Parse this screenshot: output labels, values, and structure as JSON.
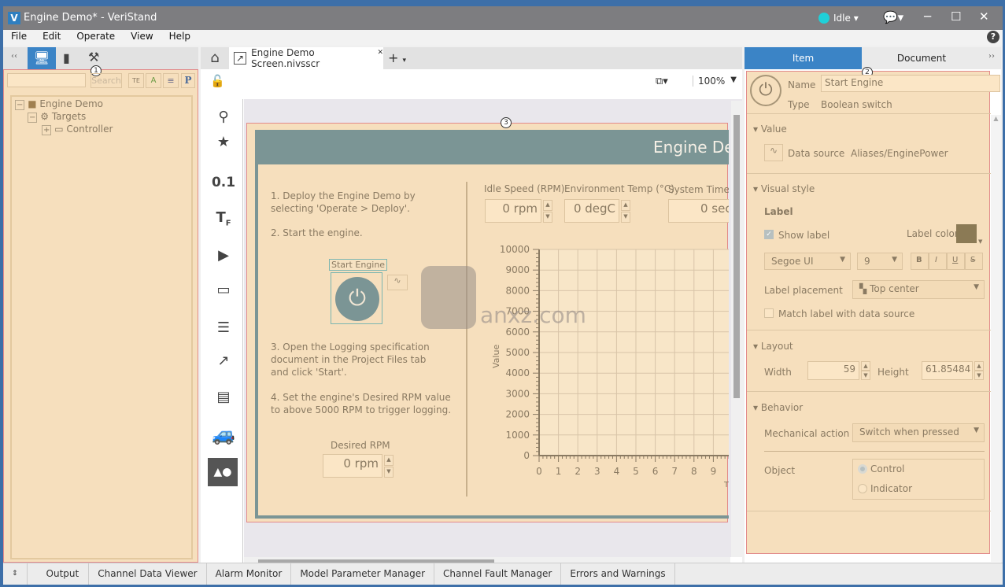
{
  "window": {
    "title": "Engine Demo* - VeriStand",
    "status": "Idle",
    "status_color": "#1fd0d8",
    "logo": "V"
  },
  "menu": [
    "File",
    "Edit",
    "Operate",
    "View",
    "Help"
  ],
  "left_panel": {
    "search_placeholder": "",
    "search_label": "Search",
    "badge": "1",
    "tree": [
      {
        "label": "Engine Demo",
        "icon": "cube-icon",
        "toggle": "−"
      },
      {
        "label": "Targets",
        "icon": "targets-icon",
        "toggle": "−"
      },
      {
        "label": "Controller",
        "icon": "controller-icon",
        "toggle": "+"
      }
    ],
    "tool_buttons": [
      "TE",
      "A",
      "≡",
      "P"
    ]
  },
  "doc_tabs": {
    "active": "Engine Demo Screen.nivsscr",
    "zoom": "100%",
    "badge": "3"
  },
  "palette": [
    "search-icon",
    "star-icon",
    "numeric-icon",
    "text-format-icon",
    "play-icon",
    "dropdown-icon",
    "list-icon",
    "graph-icon",
    "panel-icon",
    "jeep-icon",
    "shapes-icon"
  ],
  "palette_numeric": "0.1",
  "screen": {
    "header": "Engine De",
    "steps": [
      "1. Deploy the Engine Demo by selecting 'Operate > Deploy'.",
      "2. Start the engine.",
      "3. Open the Logging specification document in the Project Files tab and click 'Start'.",
      "4. Set the engine's Desired RPM value to above 5000 RPM to trigger logging."
    ],
    "start_engine_label": "Start Engine",
    "desired_rpm_label": "Desired RPM",
    "desired_rpm_value": "0 rpm",
    "idle_speed_label": "Idle Speed (RPM)",
    "idle_speed_value": "0 rpm",
    "env_temp_label": "Environment Temp (°C)",
    "env_temp_value": "0 degC",
    "sys_time_label": "System Time (s",
    "sys_time_value": "0 sec",
    "accent": "#7b9595"
  },
  "chart_data": {
    "type": "line",
    "ylabel": "Value",
    "xlabel": "Ti",
    "ylim": [
      0,
      10000
    ],
    "xlim": [
      0,
      10
    ],
    "yticks": [
      0,
      1000,
      2000,
      3000,
      4000,
      5000,
      6000,
      7000,
      8000,
      9000,
      10000
    ],
    "xticks": [
      0,
      1,
      2,
      3,
      4,
      5,
      6,
      7,
      8,
      9,
      "1"
    ],
    "grid": true,
    "series": []
  },
  "right_panel": {
    "tabs": [
      "Item",
      "Document"
    ],
    "badge": "2",
    "name_label": "Name",
    "name_value": "Start Engine",
    "type_label": "Type",
    "type_value": "Boolean switch",
    "value_section": "Value",
    "data_source_label": "Data source",
    "data_source_value": "Aliases/EnginePower",
    "visual_section": "Visual style",
    "label_heading": "Label",
    "show_label": "Show label",
    "show_label_checked": true,
    "label_color_label": "Label color",
    "label_color": "#8b7a55",
    "font": "Segoe UI",
    "font_size": "9",
    "style_buttons": [
      "B",
      "I",
      "U",
      "S"
    ],
    "placement_label": "Label placement",
    "placement_value": "Top center",
    "match_label": "Match label with data source",
    "match_checked": false,
    "layout_section": "Layout",
    "width_label": "Width",
    "width_value": "59",
    "height_label": "Height",
    "height_value": "61.85484",
    "behavior_section": "Behavior",
    "mech_label": "Mechanical action",
    "mech_value": "Switch when pressed",
    "object_label": "Object",
    "object_options": [
      "Control",
      "Indicator"
    ],
    "object_selected": "Control"
  },
  "bottom_tabs": [
    "Output",
    "Channel Data Viewer",
    "Alarm Monitor",
    "Model Parameter Manager",
    "Channel Fault Manager",
    "Errors and Warnings"
  ],
  "watermark": "anxz.com"
}
